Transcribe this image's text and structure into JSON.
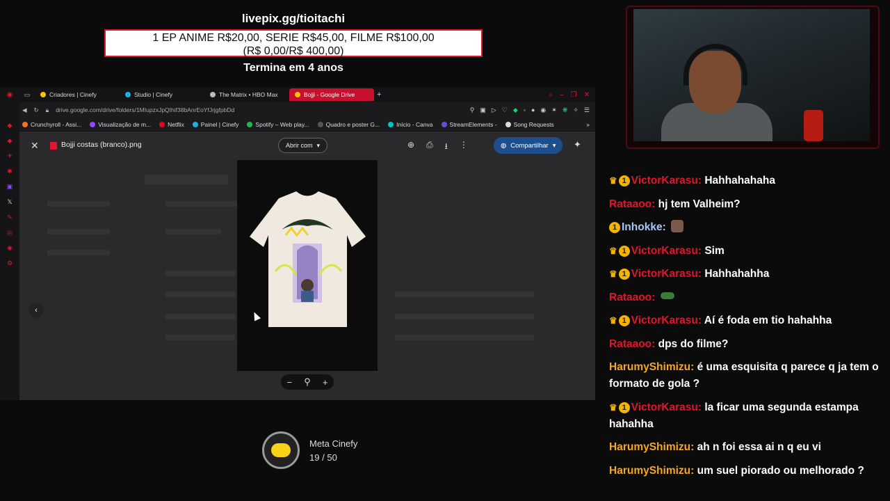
{
  "donation": {
    "url": "livepix.gg/tioitachi",
    "goal_line1": "1 EP ANIME R$20,00, SERIE R$45,00, FILME R$100,00",
    "goal_line2": "(R$ 0,00/R$ 400,00)",
    "progress_fraction": 0,
    "ends": "Termina em 4 anos"
  },
  "browser": {
    "tabs": [
      {
        "label": "Criadores | Cinefy",
        "color": "#f5c400"
      },
      {
        "label": "Studio | Cinefy",
        "color": "#22b0d8"
      },
      {
        "label": "The Matrix • HBO Max",
        "color": "#bbbbbb"
      },
      {
        "label": "Bojji - Google Drive",
        "color": "#f5c400",
        "active": true
      }
    ],
    "new_tab": "+",
    "address": "drive.google.com/drive/folders/1MIupzxJpQIhif38bAnrEoYfJrjgfpbDd",
    "bookmarks": [
      {
        "label": "Crunchyroll - Assi...",
        "color": "#f47521"
      },
      {
        "label": "Visualização de m...",
        "color": "#9146ff"
      },
      {
        "label": "Netflix",
        "color": "#e50914"
      },
      {
        "label": "Painel | Cinefy",
        "color": "#22b0d8"
      },
      {
        "label": "Spotify – Web play...",
        "color": "#1db954"
      },
      {
        "label": "Quadro e poster G...",
        "color": "#555555"
      },
      {
        "label": "Início - Canva",
        "color": "#00c4cc"
      },
      {
        "label": "StreamElements -",
        "color": "#6a4bd8"
      },
      {
        "label": "Song Requests",
        "color": "#dddddd"
      }
    ],
    "more": "»"
  },
  "viewer": {
    "file_name": "Bojji costas (branco).png",
    "open_with": "Abrir com",
    "share": "Compartilhar",
    "icons": [
      "drive-add-icon",
      "print-icon",
      "download-icon",
      "more-vert-icon"
    ]
  },
  "meta": {
    "title": "Meta Cinefy",
    "current": "19",
    "separator": "/",
    "goal": "50"
  },
  "chat": [
    {
      "badges": [
        "crown",
        "one"
      ],
      "user": "VictorKarasu",
      "color": "#e0162b",
      "text": "Hahhahahaha"
    },
    {
      "badges": [],
      "user": "Rataaoo",
      "color": "#e0162b",
      "text": "hj tem Valheim?"
    },
    {
      "badges": [
        "one"
      ],
      "user": "Inhokke",
      "color": "#a8c8f0",
      "text": "",
      "emote": "face"
    },
    {
      "badges": [
        "crown",
        "one"
      ],
      "user": "VictorKarasu",
      "color": "#e0162b",
      "text": "Sim"
    },
    {
      "badges": [
        "crown",
        "one"
      ],
      "user": "VictorKarasu",
      "color": "#e0162b",
      "text": "Hahhahahha"
    },
    {
      "badges": [],
      "user": "Rataaoo",
      "color": "#e0162b",
      "text": "",
      "emote": "green"
    },
    {
      "badges": [
        "crown",
        "one"
      ],
      "user": "VictorKarasu",
      "color": "#e0162b",
      "text": "Aí é foda em tio hahahha"
    },
    {
      "badges": [],
      "user": "Rataaoo",
      "color": "#e0162b",
      "text": "dps do filme?"
    },
    {
      "badges": [],
      "user": "HarumyShimizu",
      "color": "#f5a623",
      "text": "é uma esquisita q parece q ja tem o formato de gola ?"
    },
    {
      "badges": [
        "crown",
        "one"
      ],
      "user": "VictorKarasu",
      "color": "#e0162b",
      "text": "la ficar uma segunda estampa hahahha"
    },
    {
      "badges": [],
      "user": "HarumyShimizu",
      "color": "#f5a623",
      "text": "ah n foi essa ai n q eu vi"
    },
    {
      "badges": [],
      "user": "HarumyShimizu",
      "color": "#f5a623",
      "text": "um suel piorado ou melhorado ?"
    }
  ]
}
